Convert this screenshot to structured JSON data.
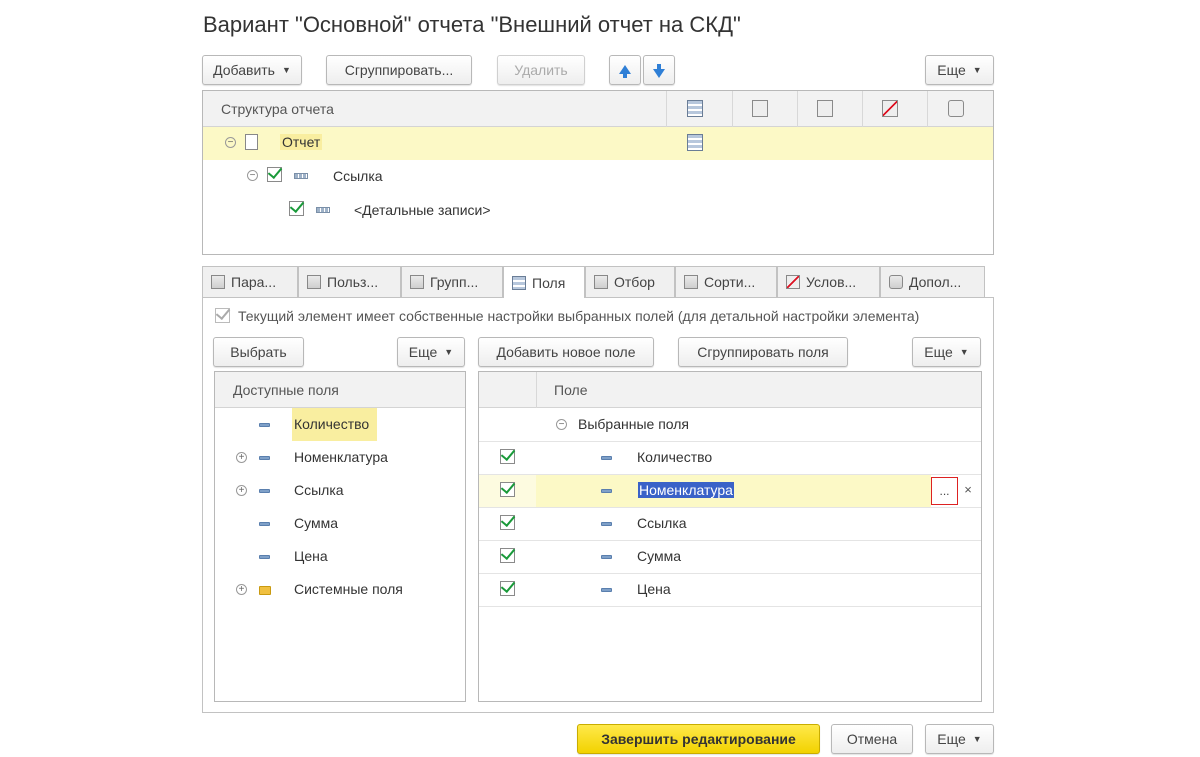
{
  "window": {
    "title": "Вариант \"Основной\" отчета \"Внешний отчет на СКД\""
  },
  "top_toolbar": {
    "add_label": "Добавить",
    "group_label": "Сгруппировать...",
    "delete_label": "Удалить",
    "more_label": "Еще"
  },
  "structure": {
    "header": "Структура отчета",
    "rows": [
      {
        "label": "Отчет"
      },
      {
        "label": "Ссылка"
      },
      {
        "label": "<Детальные записи>"
      }
    ]
  },
  "tabs": [
    {
      "label": "Пара..."
    },
    {
      "label": "Польз..."
    },
    {
      "label": "Групп..."
    },
    {
      "label": "Поля"
    },
    {
      "label": "Отбор"
    },
    {
      "label": "Сорти..."
    },
    {
      "label": "Услов..."
    },
    {
      "label": "Допол..."
    }
  ],
  "fields_tab": {
    "own_settings_label": "Текущий элемент имеет собственные настройки выбранных полей (для детальной настройки элемента)",
    "choose_label": "Выбрать",
    "more_left_label": "Еще",
    "add_new_field_label": "Добавить новое поле",
    "group_fields_label": "Сгруппировать поля",
    "more_right_label": "Еще",
    "available": {
      "header": "Доступные поля",
      "items": [
        "Количество",
        "Номенклатура",
        "Ссылка",
        "Сумма",
        "Цена",
        "Системные поля"
      ]
    },
    "selected": {
      "header": "Поле",
      "group_label": "Выбранные поля",
      "items": [
        "Количество",
        "Номенклатура",
        "Ссылка",
        "Сумма",
        "Цена"
      ],
      "ellipsis_label": "...",
      "clear_label": "×"
    }
  },
  "footer": {
    "finish_label": "Завершить редактирование",
    "cancel_label": "Отмена",
    "more_label": "Еще"
  },
  "colors": {
    "accent_yellow": "#f5d800",
    "row_highlight": "#fcf9c6",
    "selection_blue": "#3a62c8",
    "check_green": "#1a9a3a"
  }
}
